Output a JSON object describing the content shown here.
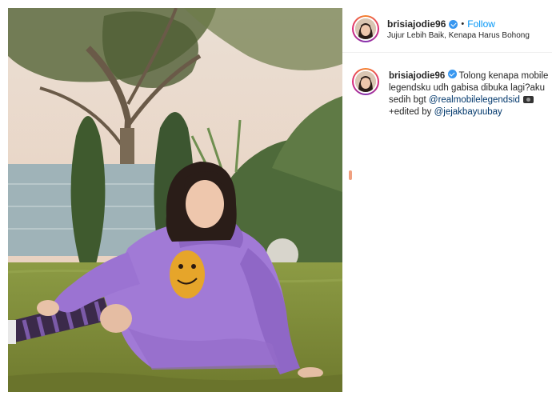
{
  "post": {
    "username": "brisiajodie96",
    "separator": "•",
    "follow_label": "Follow",
    "location": "Jujur Lebih Baik, Kenapa Harus Bohong",
    "verified_icon": "verified-badge-icon"
  },
  "caption": {
    "username": "brisiajodie96",
    "text_main": "Tolong kenapa mobile legendsku udh gabisa dibuka lagi?aku sedih bgt",
    "mention_1": "@realmobilelegendsid",
    "camera_icon": "movie-camera-icon",
    "edited_text": "+edited by",
    "mention_2": "@jejakbayuubay"
  },
  "colors": {
    "link_blue": "#0095f6",
    "mention_blue": "#00376b",
    "verified_blue": "#3897f0",
    "hoodie_purple": "#a17ad6",
    "grass_green": "#8b9a3a"
  }
}
